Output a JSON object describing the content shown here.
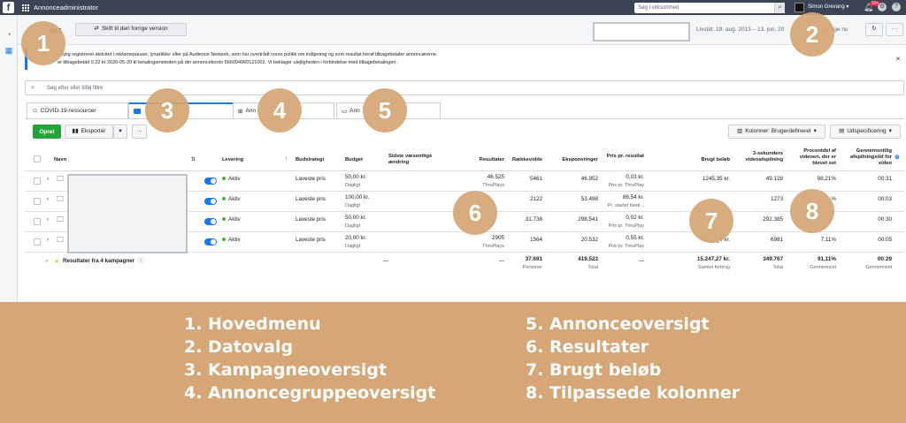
{
  "topbar": {
    "brand_icon": "f",
    "app_title": "Annonceadministrator",
    "search_placeholder": "Søg i virksomhed",
    "user_name": "Simon Grevang ▾",
    "notif_count": "99+",
    "colors": {
      "bar": "#3b4354"
    }
  },
  "header": {
    "title": "ner",
    "switch_label": "Skift til den forrige version",
    "date_range": "Livstid: 19. aug. 2013 – 13. jun. 20",
    "updated": "ret lige nu"
  },
  "notice": {
    "line1": "r nylig registreret aktivitet i reklamepauser, lynartikler eller på Audience Network, som har overtrådt vores politik om indtjening og som resultat heraf tilbagebetaler annoncørerne.",
    "line2": "er tilbagebetalt 0,22 kr 2020-05-20 til betalingsmetoden på din annoncekonto 5660949601210​02. Vi beklager ulejligheden i forbindelse med tilbagebetalingen."
  },
  "filter": {
    "placeholder": "Søg efter eller tilføj filtre"
  },
  "tabs": [
    {
      "label": "COVID-19-ressourcer"
    },
    {
      "label": ""
    },
    {
      "label": "Ann"
    },
    {
      "label": "Ann"
    }
  ],
  "toolbar": {
    "create": "Opret",
    "export": "Eksportér",
    "columns": "Kolonner: Brugerdefineret",
    "breakdown": "Udspecificering"
  },
  "table": {
    "headers": {
      "name": "Navn",
      "delivery": "Levering",
      "bid": "Budstrategi",
      "budget": "Budget",
      "last_change": "Sidste væsentlige ændring",
      "results": "Resultater",
      "reach": "Rækkevidde",
      "impressions": "Eksponeringer",
      "cpr": "Pris pr. resultat",
      "spent": "Brugt beløb",
      "views3s": "3-sekunders videoafspilning",
      "pct_watched": "Procentdel af videoen, der er blevet set",
      "avg_time": "Gennemsnitlig afspilningstid for video"
    },
    "rows": [
      {
        "delivery": "Aktiv",
        "bid": "Laveste pris",
        "budget": "50,00 kr.",
        "budget_sub": "Dagligt",
        "results": "46.525",
        "results_sub": "ThruPlays",
        "reach": "5461",
        "impressions": "46.952",
        "cpr": "0,03 kr.",
        "cpr_sub": "Pris pr. ThruPlay",
        "spent": "1245,35 kr.",
        "views3s": "49.128",
        "pct": "98,21%",
        "avg": "00:31"
      },
      {
        "delivery": "Aktiv",
        "bid": "Laveste pris",
        "budget": "100,00 kr.",
        "budget_sub": "Dagligt",
        "results": "",
        "results_sub": "S",
        "reach": "2122",
        "impressions": "53.498",
        "cpr": "86,54 kr.",
        "cpr_sub": "Pr. startet besk...",
        "spent": "",
        "views3s": "1273",
        "pct": "%",
        "avg": "00:03"
      },
      {
        "delivery": "Aktiv",
        "bid": "Laveste pris",
        "budget": "50,00 kr.",
        "budget_sub": "Dagligt",
        "results": "",
        "results_sub": "",
        "reach": "31.738",
        "impressions": "298.541",
        "cpr": "0,02 kr.",
        "cpr_sub": "Pris pr. ThruPlay",
        "spent": "",
        "views3s": "292.385",
        "pct": "",
        "avg": "00:30"
      },
      {
        "delivery": "Aktiv",
        "bid": "Laveste pris",
        "budget": "20,00 kr.",
        "budget_sub": "Dagligt",
        "results": "2905",
        "results_sub": "ThruPlays",
        "reach": "1564",
        "impressions": "20.532",
        "cpr": "0,55 kr.",
        "cpr_sub": "Pris pr. ThruPlay",
        "spent": "15__,_4 kr.",
        "views3s": "6981",
        "pct": "7,11%",
        "avg": "00:05"
      }
    ],
    "total": {
      "label": "Resultater fra 4 kampagner",
      "last_change": "—",
      "results": "—",
      "reach": "37.691",
      "reach_sub": "Personer",
      "impressions": "419.523",
      "impressions_sub": "Total",
      "cpr": "—",
      "spent": "15.247,27 kr.",
      "spent_sub": "Samlet forbrug",
      "views3s": "349.767",
      "views3s_sub": "Total",
      "pct": "91,11%",
      "pct_sub": "Gennemsnit",
      "avg": "00:29",
      "avg_sub": "Gennemsnit"
    }
  },
  "circles": [
    "1",
    "2",
    "3",
    "4",
    "5",
    "6",
    "7",
    "8"
  ],
  "legend": {
    "items": [
      "1. Hovedmenu",
      "2. Datovalg",
      "3. Kampagneoversigt",
      "4. Annoncegruppeoversigt",
      "5. Annonceoversigt",
      "6. Resultater",
      "7. Brugt beløb",
      "8. Tilpassede kolonner"
    ],
    "bg_color": "#d6a676"
  }
}
